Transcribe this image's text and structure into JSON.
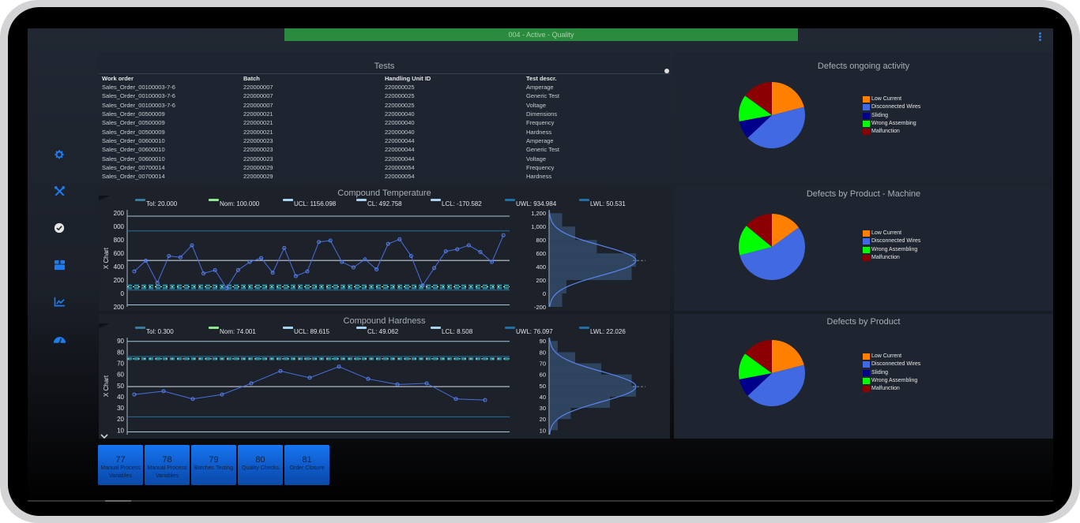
{
  "status_bar": {
    "text": "004 - Active - Quality",
    "color": "#2a8a3e"
  },
  "menu_icon": "kebab-menu-icon",
  "sidebar": {
    "items": [
      {
        "icon": "gear-icon",
        "color": "#1e7bf0"
      },
      {
        "icon": "tools-icon",
        "color": "#1e7bf0"
      },
      {
        "icon": "check-circle-icon",
        "color": "#e6e6e6"
      },
      {
        "icon": "box-icon",
        "color": "#1e7bf0"
      },
      {
        "icon": "chart-line-icon",
        "color": "#1e7bf0"
      },
      {
        "icon": "gauge-icon",
        "color": "#1e7bf0"
      }
    ]
  },
  "tests": {
    "title": "Tests",
    "columns": [
      "Work order",
      "Batch",
      "Handling Unit ID",
      "Test descr."
    ],
    "rows": [
      [
        "Sales_Order_00100003-7-6",
        "220000007",
        "220000025",
        "Amperage"
      ],
      [
        "Sales_Order_00100003-7-6",
        "220000007",
        "220000025",
        "Generic Test"
      ],
      [
        "Sales_Order_00100003-7-6",
        "220000007",
        "220000025",
        "Voltage"
      ],
      [
        "Sales_Order_00500009",
        "220000021",
        "220000040",
        "Dimensions"
      ],
      [
        "Sales_Order_00500009",
        "220000021",
        "220000040",
        "Frequency"
      ],
      [
        "Sales_Order_00500009",
        "220000021",
        "220000040",
        "Hardness"
      ],
      [
        "Sales_Order_00600010",
        "220000023",
        "220000044",
        "Amperage"
      ],
      [
        "Sales_Order_00600010",
        "220000023",
        "220000044",
        "Generic Test"
      ],
      [
        "Sales_Order_00600010",
        "220000023",
        "220000044",
        "Voltage"
      ],
      [
        "Sales_Order_00700014",
        "220000029",
        "220000054",
        "Frequency"
      ],
      [
        "Sales_Order_00700014",
        "220000029",
        "220000054",
        "Hardness"
      ]
    ]
  },
  "chart_data": [
    {
      "type": "line",
      "title": "Compound Temperature",
      "ylabel": "X Chart",
      "legend": [
        {
          "label": "Tol: 20.000",
          "color": "#3a7a9c"
        },
        {
          "label": "Nom: 100.000",
          "color": "#8fe88f"
        },
        {
          "label": "UCL: 1156.098",
          "color": "#a7d3ee"
        },
        {
          "label": "CL: 492.758",
          "color": "#a7d3ee"
        },
        {
          "label": "LCL: -170.582",
          "color": "#a7d3ee"
        },
        {
          "label": "UWL: 934.984",
          "color": "#1d6fa5"
        },
        {
          "label": "LWL: 50.531",
          "color": "#1d6fa5"
        }
      ],
      "lines": {
        "tol": 20,
        "nom": 100,
        "ucl": 1156.098,
        "cl": 492.758,
        "lcl": -170.582,
        "uwl": 934.984,
        "lwl": 50.531
      },
      "ylim": [
        -200,
        1250
      ],
      "yticks": [
        -200,
        0,
        200,
        400,
        600,
        800,
        1000,
        1200
      ],
      "ytick_labels_main": [
        "200",
        "0",
        "200",
        "400",
        "600",
        "800",
        "000",
        "200"
      ],
      "histogram_yticks": [
        "-200",
        "0",
        "200",
        "400",
        "600",
        "800",
        "1,000",
        "1,200"
      ],
      "values": [
        330,
        490,
        160,
        560,
        540,
        720,
        300,
        350,
        80,
        350,
        470,
        530,
        310,
        680,
        260,
        330,
        770,
        790,
        470,
        390,
        510,
        360,
        740,
        810,
        560,
        120,
        380,
        630,
        660,
        720,
        620,
        470,
        870
      ],
      "histogram": {
        "mean": 492.758,
        "bins": [
          [
            -200,
            0,
            0.15
          ],
          [
            0,
            200,
            0.2
          ],
          [
            200,
            400,
            0.95
          ],
          [
            400,
            600,
            1.0
          ],
          [
            600,
            800,
            0.55
          ],
          [
            800,
            1000,
            0.3
          ],
          [
            1000,
            1200,
            0.15
          ]
        ]
      }
    },
    {
      "type": "line",
      "title": "Compound Hardness",
      "ylabel": "X Chart",
      "legend": [
        {
          "label": "Tol: 0.300",
          "color": "#3a7a9c"
        },
        {
          "label": "Nom: 74.001",
          "color": "#8fe88f"
        },
        {
          "label": "UCL: 89.615",
          "color": "#a7d3ee"
        },
        {
          "label": "CL: 49.062",
          "color": "#a7d3ee"
        },
        {
          "label": "LCL: 8.508",
          "color": "#a7d3ee"
        },
        {
          "label": "UWL: 76.097",
          "color": "#1d6fa5"
        },
        {
          "label": "LWL: 22.026",
          "color": "#1d6fa5"
        }
      ],
      "lines": {
        "tol": 0.3,
        "nom": 74.001,
        "ucl": 89.615,
        "cl": 49.062,
        "lcl": 8.508,
        "uwl": 76.097,
        "lwl": 22.026
      },
      "ylim": [
        6,
        93
      ],
      "yticks": [
        10,
        20,
        30,
        40,
        50,
        60,
        70,
        80,
        90
      ],
      "histogram_yticks": [
        "10",
        "20",
        "30",
        "40",
        "50",
        "60",
        "70",
        "80",
        "90"
      ],
      "values": [
        42,
        45,
        38,
        42,
        52,
        63,
        57,
        67,
        56,
        51,
        52,
        38,
        37
      ],
      "histogram": {
        "mean": 49.062,
        "bins": [
          [
            10,
            20,
            0.1
          ],
          [
            20,
            30,
            0.25
          ],
          [
            30,
            40,
            0.7
          ],
          [
            40,
            50,
            1.0
          ],
          [
            50,
            60,
            0.95
          ],
          [
            60,
            70,
            0.6
          ],
          [
            70,
            80,
            0.3
          ],
          [
            80,
            90,
            0.1
          ]
        ]
      }
    },
    {
      "type": "pie",
      "title": "Defects ongoing activity",
      "labels": [
        "Low Current",
        "Disconnected Wires",
        "Sliding",
        "Wrong Assembing",
        "Malfunction"
      ],
      "colors": [
        "#ff8000",
        "#4169e1",
        "#00008b",
        "#00ff00",
        "#8b0000"
      ],
      "values": [
        21,
        42,
        9,
        13,
        15
      ]
    },
    {
      "type": "pie",
      "title": "Defects by Product - Machine",
      "labels": [
        "Low Current",
        "Disconnected Wires",
        "Wrong Assembling",
        "Malfunction"
      ],
      "colors": [
        "#ff8000",
        "#4169e1",
        "#00ff00",
        "#8b0000"
      ],
      "values": [
        15,
        56,
        15,
        14
      ]
    },
    {
      "type": "pie",
      "title": "Defects by Product",
      "labels": [
        "Low Current",
        "Disconnected Wires",
        "Sliding",
        "Wrong Assembling",
        "Malfunction"
      ],
      "colors": [
        "#ff8000",
        "#4169e1",
        "#00008b",
        "#00ff00",
        "#8b0000"
      ],
      "values": [
        21,
        42,
        9,
        13,
        15
      ]
    }
  ],
  "tiles": [
    {
      "num": "77",
      "label": "Manual Process Variables"
    },
    {
      "num": "78",
      "label": "Manual Process Variables"
    },
    {
      "num": "79",
      "label": "Batches Testing"
    },
    {
      "num": "80",
      "label": "Quality Checks"
    },
    {
      "num": "81",
      "label": "Order Closure"
    }
  ]
}
